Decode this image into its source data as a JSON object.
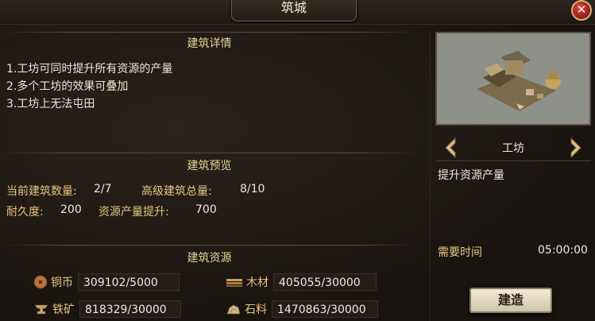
{
  "window": {
    "title": "筑城",
    "close_symbol": "✕"
  },
  "details": {
    "heading": "建筑详情",
    "lines": [
      "1.工坊可同时提升所有资源的产量",
      "2.多个工坊的效果可叠加",
      "3.工坊上无法屯田"
    ]
  },
  "preview": {
    "heading": "建筑预览",
    "current_count_label": "当前建筑数量:",
    "current_count_value": "2/7",
    "advanced_total_label": "高级建筑总量:",
    "advanced_total_value": "8/10",
    "durability_label": "耐久度:",
    "durability_value": "200",
    "production_label": "资源产量提升:",
    "production_value": "700"
  },
  "resources": {
    "heading": "建筑资源",
    "items": [
      {
        "label": "铜币",
        "value": "309102/5000",
        "icon": "copper-coin-icon"
      },
      {
        "label": "木材",
        "value": "405055/30000",
        "icon": "wood-icon"
      },
      {
        "label": "铁矿",
        "value": "818329/30000",
        "icon": "iron-anvil-icon"
      },
      {
        "label": "石料",
        "value": "1470863/30000",
        "icon": "stone-icon"
      }
    ]
  },
  "building": {
    "name": "工坊",
    "description": "提升资源产量",
    "time_label": "需要时间",
    "time_value": "05:00:00",
    "build_button": "建造"
  },
  "colors": {
    "accent_gold": "#e5c77f",
    "close_red": "#c2362a"
  }
}
